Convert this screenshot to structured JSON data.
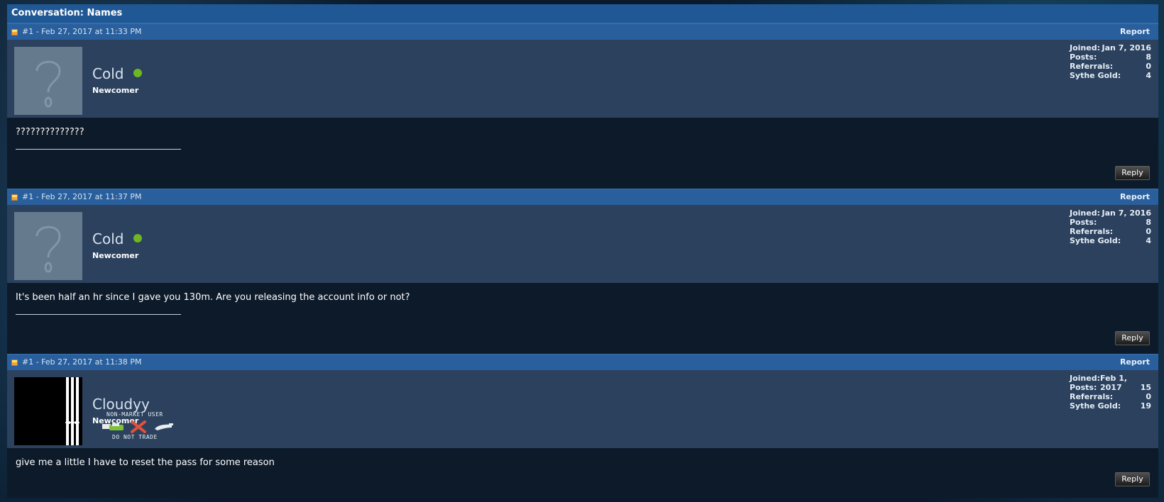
{
  "conversation": {
    "title": "Conversation: Names"
  },
  "posts": [
    {
      "date": "#1 - Feb 27, 2017 at 11:33 PM",
      "report": "Report",
      "username": "Cold",
      "online": true,
      "rank": "Newcomer",
      "avatar": "question-mark-avatar",
      "stats": {
        "joined_label": "Joined:",
        "joined": "Jan 7, 2016",
        "posts_label": "Posts:",
        "posts": "8",
        "referrals_label": "Referrals:",
        "referrals": "0",
        "gold_label": "Sythe Gold:",
        "gold": "4"
      },
      "message": "??????????????",
      "reply": "Reply"
    },
    {
      "date": "#1 - Feb 27, 2017 at 11:37 PM",
      "report": "Report",
      "username": "Cold",
      "online": true,
      "rank": "Newcomer",
      "avatar": "question-mark-avatar",
      "stats": {
        "joined_label": "Joined:",
        "joined": "Jan 7, 2016",
        "posts_label": "Posts:",
        "posts": "8",
        "referrals_label": "Referrals:",
        "referrals": "0",
        "gold_label": "Sythe Gold:",
        "gold": "4"
      },
      "message": "It's been half an hr since I gave you 130m. Are you releasing the account info or not?",
      "reply": "Reply"
    },
    {
      "date": "#1 - Feb 27, 2017 at 11:38 PM",
      "report": "Report",
      "username": "Cloudyy",
      "online": false,
      "rank": "Newcomer",
      "avatar": "adidas-avatar",
      "badge": {
        "top": "NON-MARKET USER",
        "bottom": "DO NOT TRADE",
        "icons": [
          "handshake-icon",
          "red-x-icon",
          "hand-icon"
        ]
      },
      "stats": {
        "joined_label": "Joined:",
        "joined": "Feb 1, 2017",
        "posts_label": "Posts:",
        "posts": "15",
        "referrals_label": "Referrals:",
        "referrals": "0",
        "gold_label": "Sythe Gold:",
        "gold": "19"
      },
      "message": "give me a little I have to reset the pass for some reason",
      "reply": "Reply"
    }
  ],
  "colors": {
    "header_blue": "#295f9c",
    "user_block": "#2b415e",
    "message_bg": "#0d1a2a",
    "online_green": "#6fb623"
  }
}
